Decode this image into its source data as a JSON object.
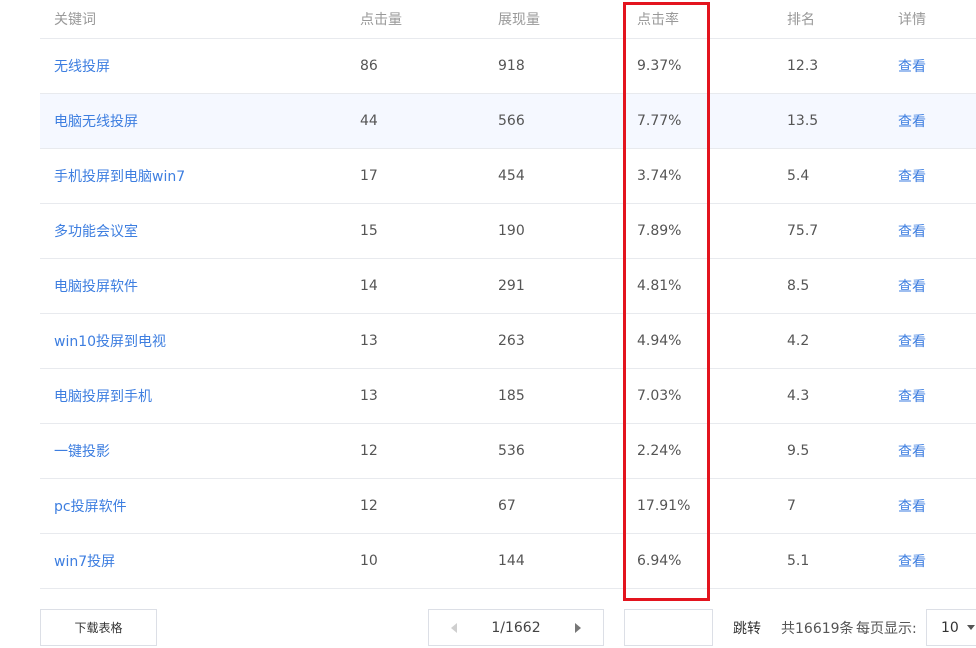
{
  "table": {
    "headers": [
      "关键词",
      "点击量",
      "展现量",
      "点击率",
      "排名",
      "详情"
    ],
    "rows": [
      {
        "keyword": "无线投屏",
        "clicks": "86",
        "impressions": "918",
        "ctr": "9.37%",
        "rank": "12.3",
        "detail": "查看"
      },
      {
        "keyword": "电脑无线投屏",
        "clicks": "44",
        "impressions": "566",
        "ctr": "7.77%",
        "rank": "13.5",
        "detail": "查看"
      },
      {
        "keyword": "手机投屏到电脑win7",
        "clicks": "17",
        "impressions": "454",
        "ctr": "3.74%",
        "rank": "5.4",
        "detail": "查看"
      },
      {
        "keyword": "多功能会议室",
        "clicks": "15",
        "impressions": "190",
        "ctr": "7.89%",
        "rank": "75.7",
        "detail": "查看"
      },
      {
        "keyword": "电脑投屏软件",
        "clicks": "14",
        "impressions": "291",
        "ctr": "4.81%",
        "rank": "8.5",
        "detail": "查看"
      },
      {
        "keyword": "win10投屏到电视",
        "clicks": "13",
        "impressions": "263",
        "ctr": "4.94%",
        "rank": "4.2",
        "detail": "查看"
      },
      {
        "keyword": "电脑投屏到手机",
        "clicks": "13",
        "impressions": "185",
        "ctr": "7.03%",
        "rank": "4.3",
        "detail": "查看"
      },
      {
        "keyword": "一键投影",
        "clicks": "12",
        "impressions": "536",
        "ctr": "2.24%",
        "rank": "9.5",
        "detail": "查看"
      },
      {
        "keyword": "pc投屏软件",
        "clicks": "12",
        "impressions": "67",
        "ctr": "17.91%",
        "rank": "7",
        "detail": "查看"
      },
      {
        "keyword": "win7投屏",
        "clicks": "10",
        "impressions": "144",
        "ctr": "6.94%",
        "rank": "5.1",
        "detail": "查看"
      }
    ]
  },
  "footer": {
    "download_label": "下载表格",
    "page_info": "1/1662",
    "jump_label": "跳转",
    "jump_value": "",
    "total_label": "共16619条",
    "per_page_label": "每页显示:",
    "per_page_value": "10"
  },
  "colors": {
    "link": "#3d7ee0",
    "highlight_row": "#f5f8ff",
    "annotation_box": "#e3141e"
  }
}
